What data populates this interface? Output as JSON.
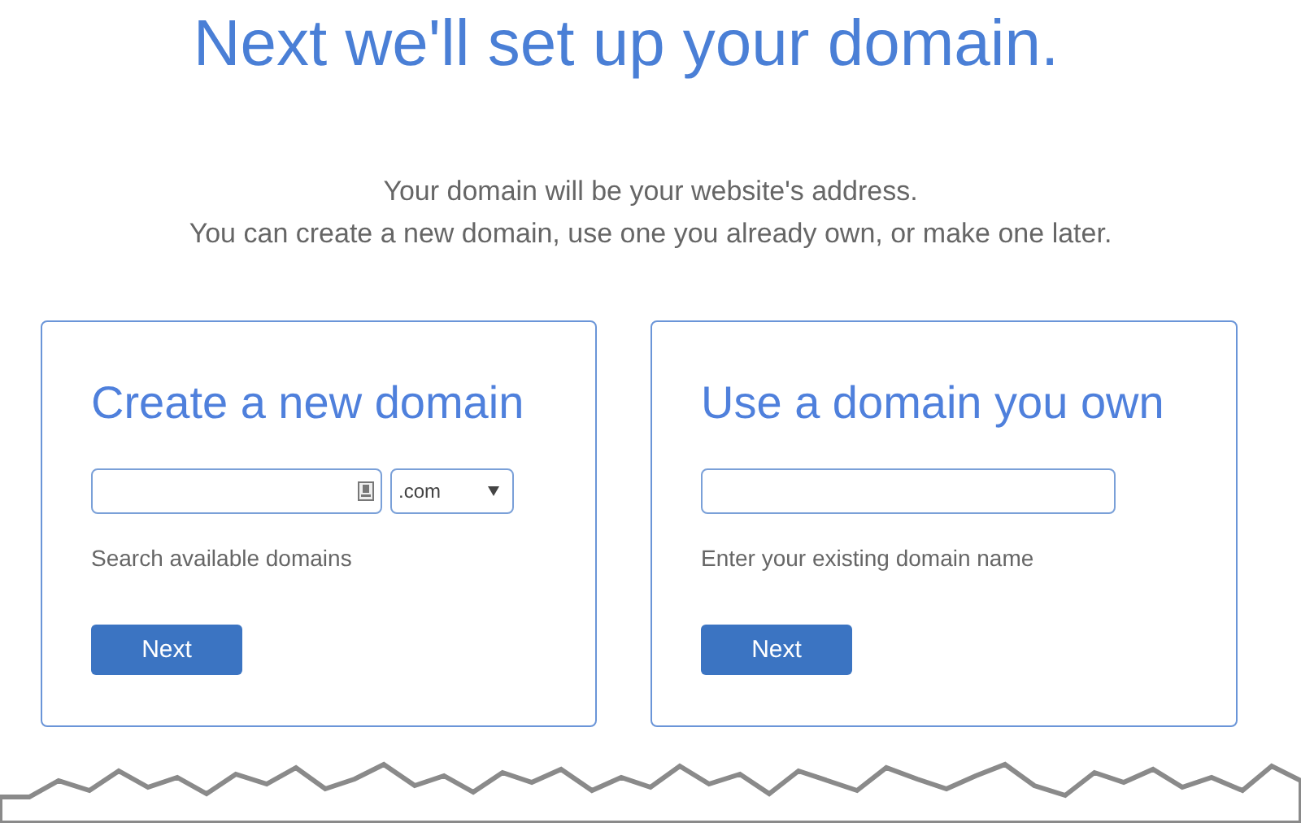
{
  "title": "Next we'll set up your domain.",
  "intro": [
    "Your domain will be your website's address.",
    "You can create a new domain, use one you already own, or make one later."
  ],
  "cards": [
    {
      "kind": "search",
      "heading": "Create a new domain",
      "tld": ".com",
      "help": "Search available domains",
      "button": "Next"
    },
    {
      "kind": "existing",
      "heading": "Use a domain you own",
      "help": "Enter your existing domain name",
      "button": "Next"
    }
  ]
}
